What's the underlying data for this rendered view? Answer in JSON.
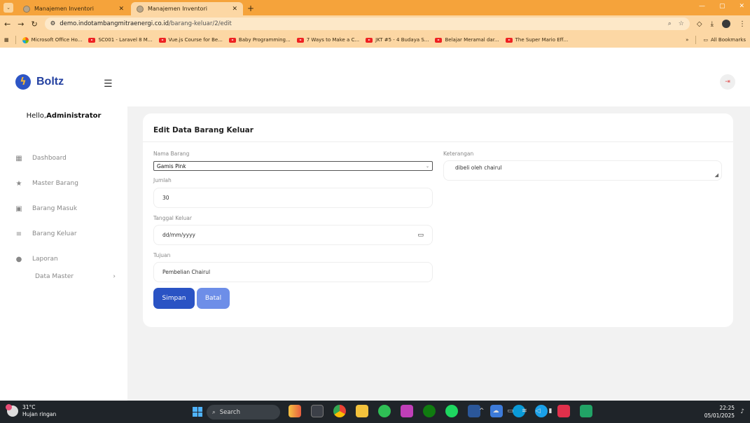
{
  "browser": {
    "tabs": [
      {
        "title": "Manajemen Inventori",
        "active": false
      },
      {
        "title": "Manajemen Inventori",
        "active": true
      }
    ],
    "new_tab": "+",
    "url_host": "demo.indotambangmitraenergi.co.id",
    "url_path": "/barang-keluar/2/edit",
    "bookmarks": [
      {
        "label": "Microsoft Office Ho...",
        "icon": "microsoft-icon"
      },
      {
        "label": "SC001 - Laravel 8 M...",
        "icon": "youtube-icon"
      },
      {
        "label": "Vue.js Course for Be...",
        "icon": "youtube-icon"
      },
      {
        "label": "Baby Programming...",
        "icon": "youtube-icon"
      },
      {
        "label": "7 Ways to Make a C...",
        "icon": "youtube-icon"
      },
      {
        "label": "JKT #5 - 4 Budaya S...",
        "icon": "youtube-icon"
      },
      {
        "label": "Belajar Meramal dar...",
        "icon": "youtube-icon"
      },
      {
        "label": "The Super Mario Eff...",
        "icon": "youtube-icon"
      }
    ],
    "bookmarks_more": "»",
    "all_bookmarks": "All Bookmarks"
  },
  "sidebar": {
    "brand": "Boltz",
    "greeting_prefix": "Hello,",
    "greeting_name": "Administrator",
    "items": [
      {
        "label": "Dashboard",
        "icon": "dashboard-icon"
      },
      {
        "label": "Master Barang",
        "icon": "star-icon"
      },
      {
        "label": "Barang Masuk",
        "icon": "image-icon"
      },
      {
        "label": "Barang Keluar",
        "icon": "list-icon"
      },
      {
        "label": "Laporan",
        "icon": "info-icon"
      }
    ],
    "data_master": "Data Master",
    "data_master_arrow": "›"
  },
  "form": {
    "title": "Edit Data Barang Keluar",
    "nama_barang_label": "Nama Barang",
    "nama_barang_value": "Gamis Pink",
    "jumlah_label": "Jumlah",
    "jumlah_value": "30",
    "tanggal_label": "Tanggal Keluar",
    "tanggal_placeholder": "dd/mm/yyyy",
    "tujuan_label": "Tujuan",
    "tujuan_value": "Pembelian Chairul",
    "keterangan_label": "Keterangan",
    "keterangan_value": "dibeli oleh chairul",
    "save_label": "Simpan",
    "cancel_label": "Batal"
  },
  "taskbar": {
    "temperature": "31°C",
    "weather": "Hujan ringan",
    "search_label": "Search",
    "time": "22:25",
    "date": "05/01/2025"
  },
  "colors": {
    "chrome_orange": "#f5a33b",
    "primary": "#2a53c4",
    "secondary": "#6d8ee8"
  }
}
